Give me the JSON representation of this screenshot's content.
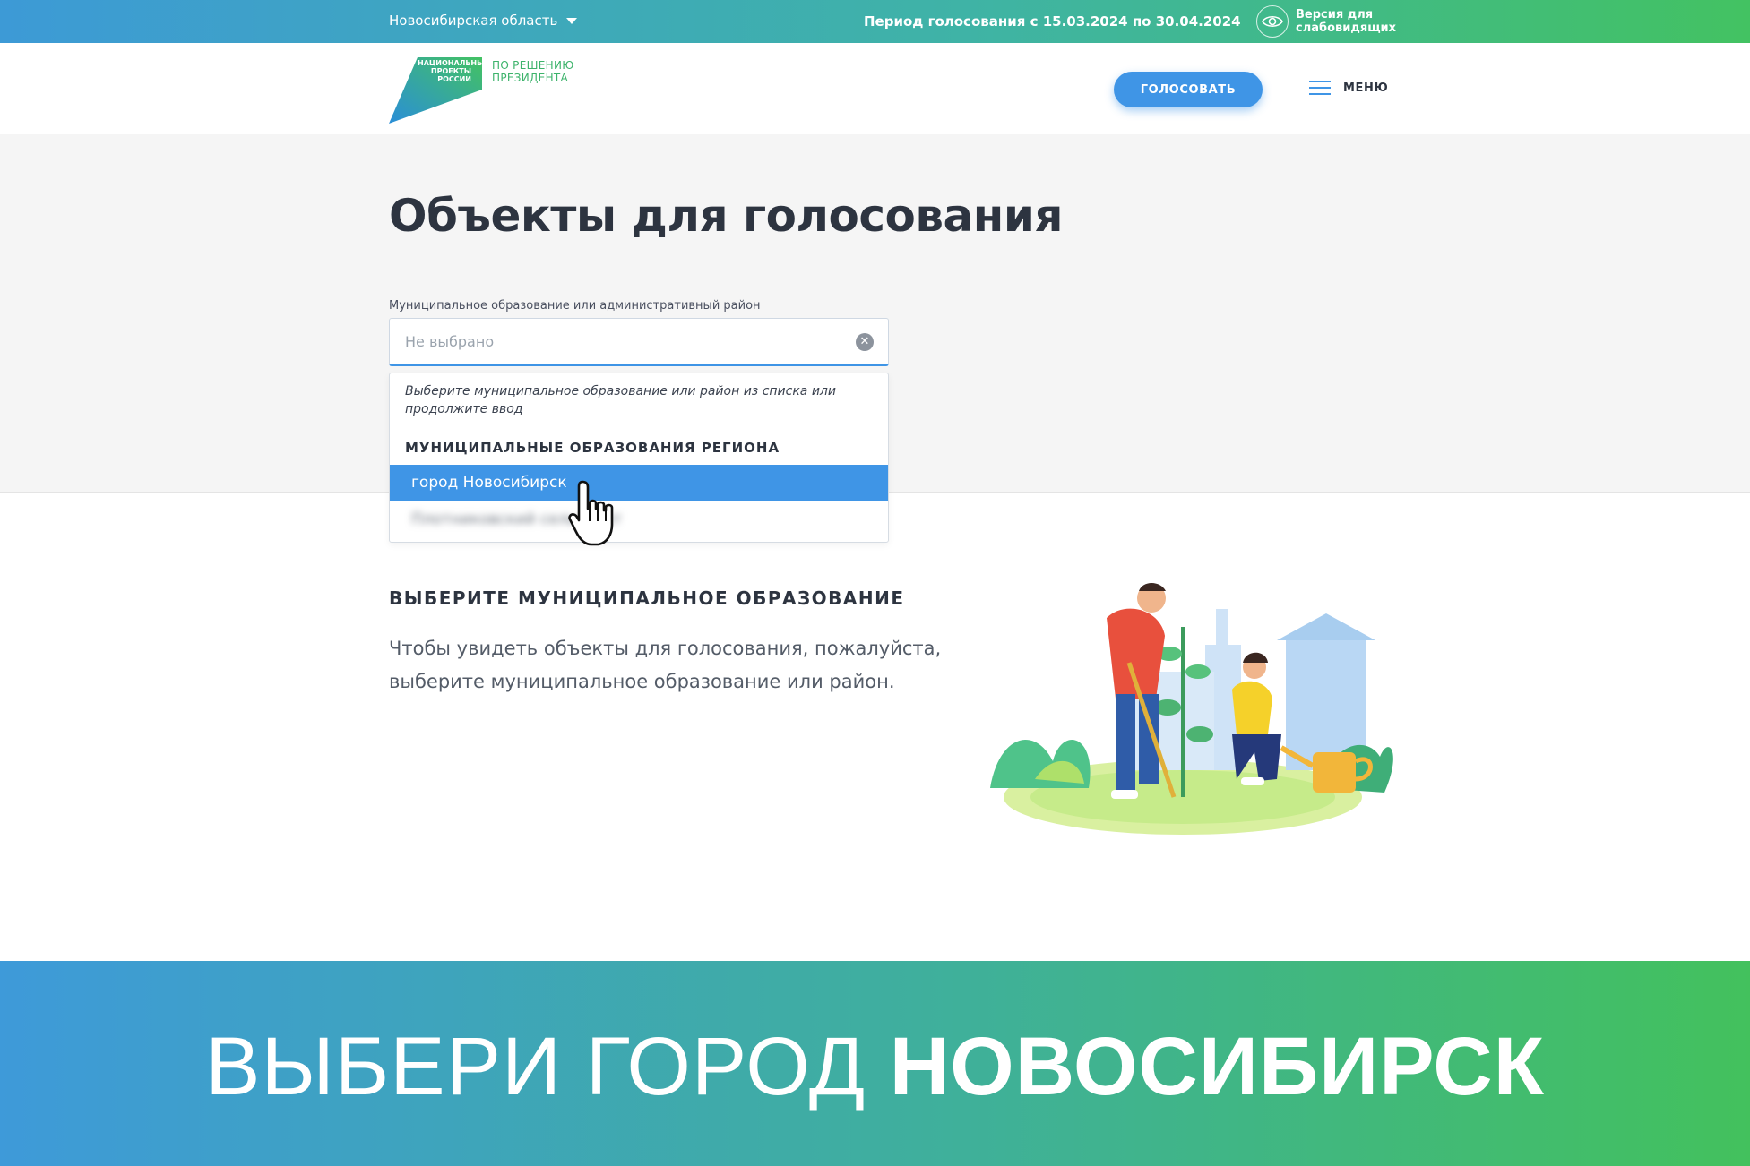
{
  "topbar": {
    "region": "Новосибирская область",
    "period": "Период голосования с 15.03.2024 по 30.04.2024",
    "accessibility": "Версия для слабовидящих"
  },
  "header": {
    "logo_small": "НАЦИОНАЛЬНЫЕ ПРОЕКТЫ РОССИИ",
    "logo_tagline": "ПО РЕШЕНИЮ ПРЕЗИДЕНТА",
    "vote_button": "ГОЛОСОВАТЬ",
    "menu_label": "МЕНЮ"
  },
  "main": {
    "title": "Объекты для голосования",
    "field_label": "Муниципальное образование или административный район",
    "field_placeholder": "Не выбрано",
    "dropdown": {
      "hint": "Выберите муниципальное образование или район из списка или продолжите ввод",
      "group_title": "МУНИЦИПАЛЬНЫЕ ОБРАЗОВАНИЯ РЕГИОНА",
      "items": [
        {
          "label": "город Новосибирск",
          "state": "highlighted"
        },
        {
          "label": "Плотниковский сельсовет",
          "state": "blurred"
        }
      ]
    },
    "section_title": "ВЫБЕРИТЕ МУНИЦИПАЛЬНОЕ ОБРАЗОВАНИЕ",
    "section_text": "Чтобы увидеть объекты для голосования, пожалуйста, выберите муниципальное образование или район."
  },
  "banner": {
    "text_regular": "ВЫБЕРИ ГОРОД ",
    "text_bold": "НОВОСИБИРСК"
  },
  "colors": {
    "accent": "#3f95e6",
    "green": "#43c262",
    "text": "#2d3440"
  }
}
